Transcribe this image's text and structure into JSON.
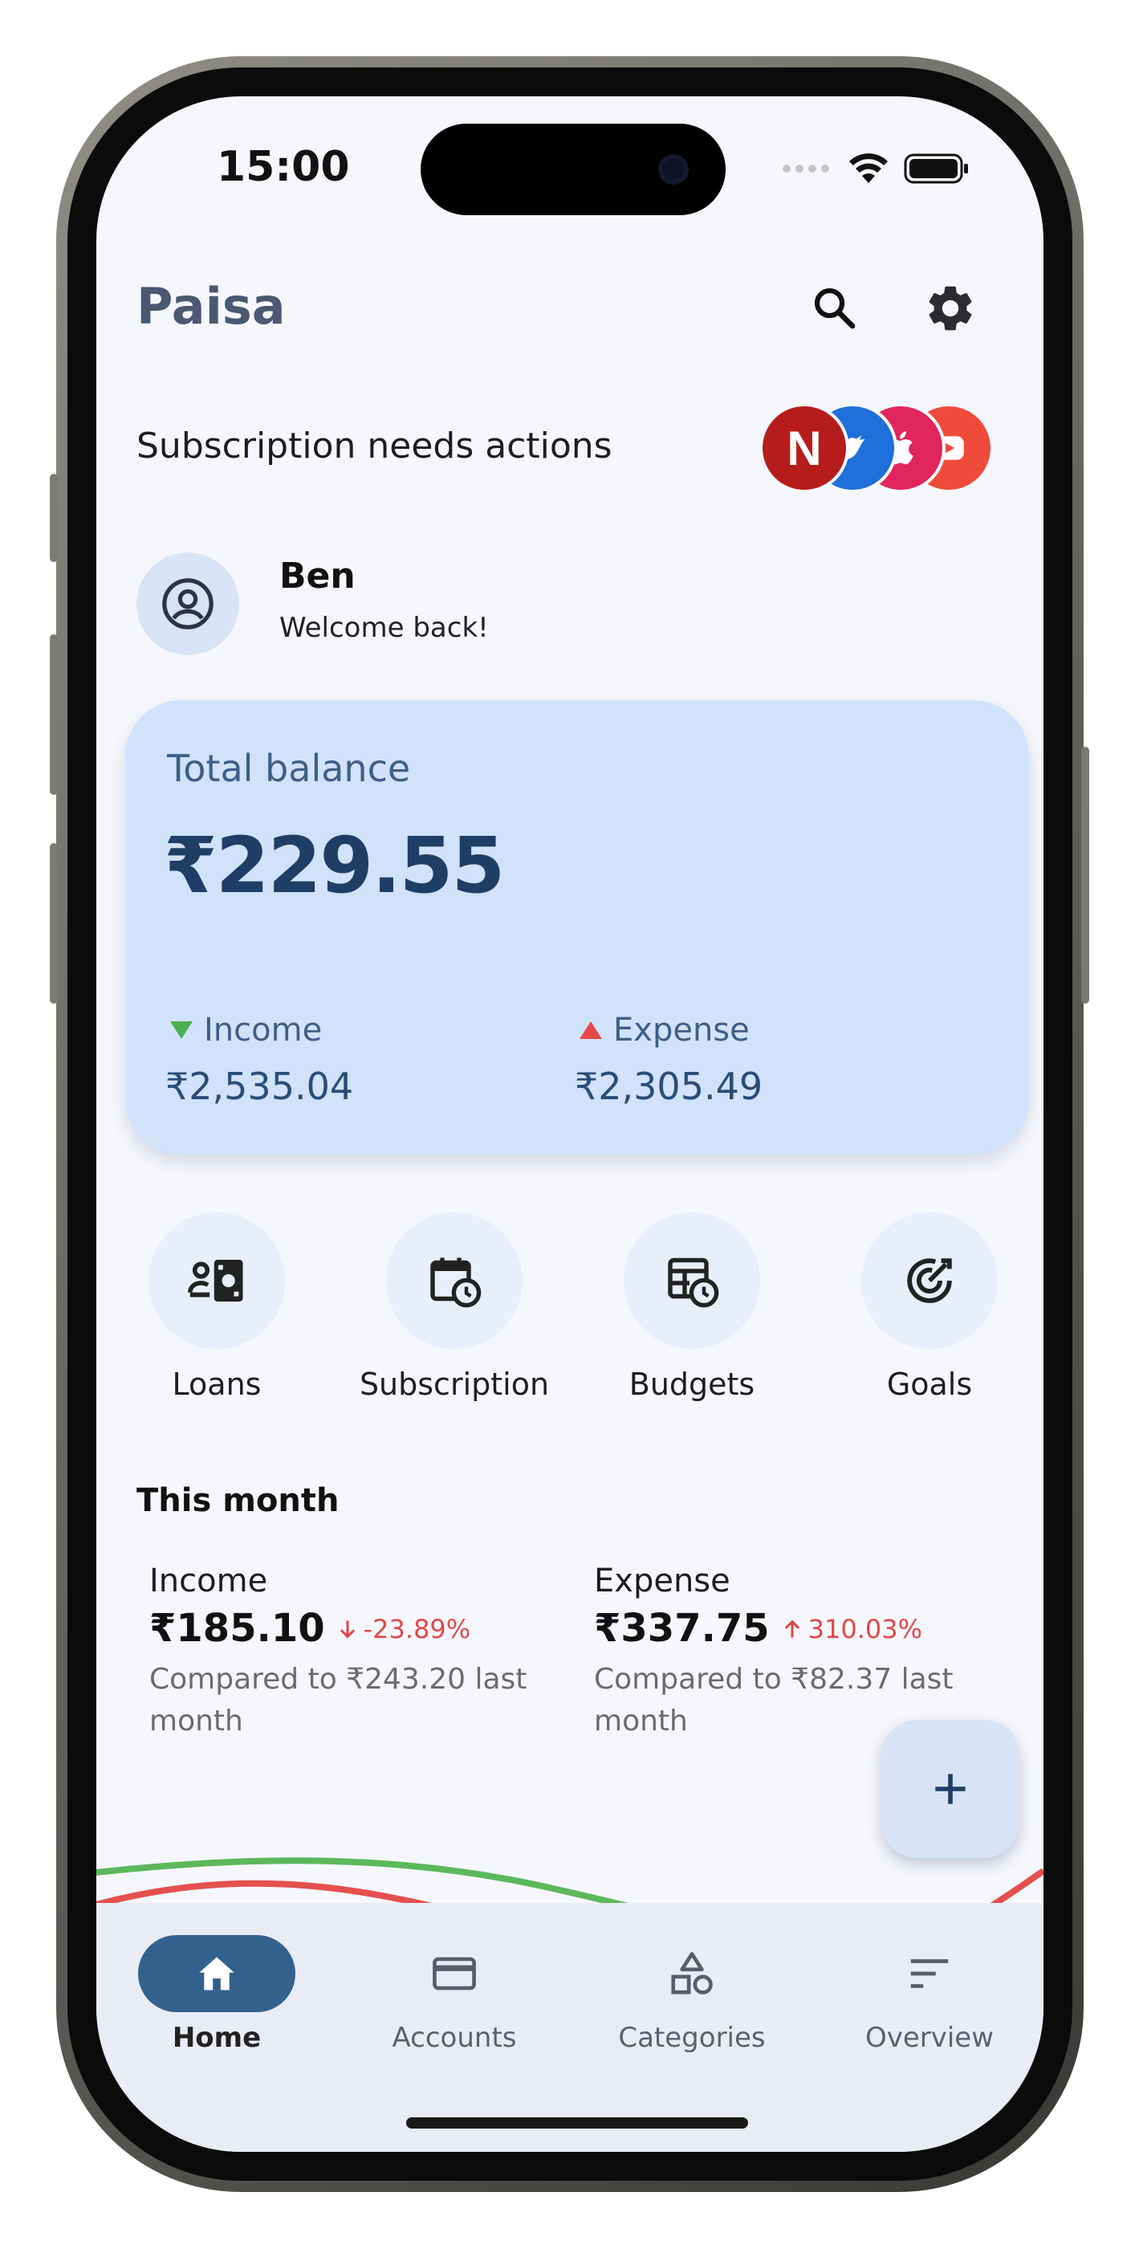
{
  "status_bar": {
    "time": "15:00"
  },
  "app_bar": {
    "title": "Paisa",
    "icons": [
      "search-icon",
      "gear-icon"
    ]
  },
  "subscription_banner": {
    "text": "Subscription needs actions",
    "avatars": [
      {
        "letter": "N",
        "color": "#b71c1c"
      },
      {
        "icon": "bird-icon",
        "color": "#1e6fd9"
      },
      {
        "icon": "apple-icon",
        "color": "#e0245e"
      },
      {
        "icon": "play-icon",
        "color": "#ef4b3c"
      }
    ]
  },
  "profile": {
    "name": "Ben",
    "subtitle": "Welcome back!",
    "icon": "user-circle-icon"
  },
  "balance_card": {
    "label": "Total balance",
    "value": "₹229.55",
    "income_label": "Income",
    "income_value": "₹2,535.04",
    "expense_label": "Expense",
    "expense_value": "₹2,305.49",
    "colors": {
      "card": "#d1e2fb",
      "income": "#4caf50",
      "expense": "#e54848"
    }
  },
  "quick_actions": [
    {
      "label": "Loans",
      "icon": "loan-icon"
    },
    {
      "label": "Subscription",
      "icon": "calendar-clock-icon"
    },
    {
      "label": "Budgets",
      "icon": "budget-icon"
    },
    {
      "label": "Goals",
      "icon": "target-icon"
    }
  ],
  "this_month": {
    "title": "This month",
    "income": {
      "label": "Income",
      "value": "₹185.10",
      "change": "-23.89%",
      "compare": "Compared to ₹243.20 last month"
    },
    "expense": {
      "label": "Expense",
      "value": "₹337.75",
      "change": "310.03%",
      "compare": "Compared to ₹82.37 last month"
    }
  },
  "fab": {
    "icon": "plus-icon"
  },
  "bottom_nav": {
    "items": [
      {
        "label": "Home",
        "icon": "home-icon",
        "active": true
      },
      {
        "label": "Accounts",
        "icon": "card-icon",
        "active": false
      },
      {
        "label": "Categories",
        "icon": "shapes-icon",
        "active": false
      },
      {
        "label": "Overview",
        "icon": "sort-lines-icon",
        "active": false
      }
    ],
    "accent": "#33618e"
  }
}
